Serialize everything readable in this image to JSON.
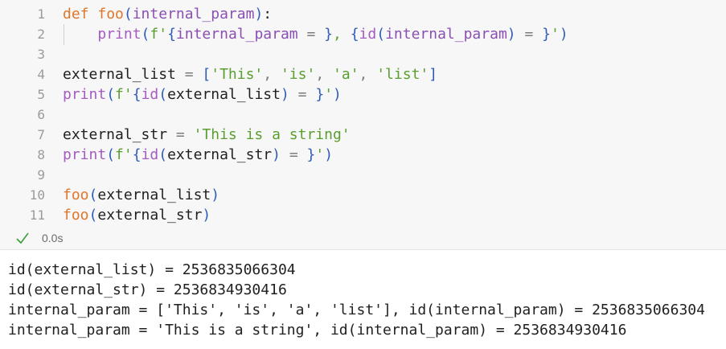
{
  "code": {
    "lines": [
      {
        "num": "1",
        "tokens": [
          [
            "kw",
            "def "
          ],
          [
            "fn",
            "foo"
          ],
          [
            "br",
            "("
          ],
          [
            "var",
            "internal_param"
          ],
          [
            "br",
            ")"
          ],
          [
            "txt",
            ":"
          ]
        ]
      },
      {
        "num": "2",
        "tokens": [
          [
            "txt",
            "    "
          ],
          [
            "bi",
            "print"
          ],
          [
            "br",
            "("
          ],
          [
            "str",
            "f'"
          ],
          [
            "br",
            "{"
          ],
          [
            "var",
            "internal_param"
          ],
          [
            "op",
            " = "
          ],
          [
            "br",
            "}"
          ],
          [
            "str",
            ", "
          ],
          [
            "br",
            "{"
          ],
          [
            "bi",
            "id"
          ],
          [
            "br",
            "("
          ],
          [
            "var",
            "internal_param"
          ],
          [
            "br",
            ")"
          ],
          [
            "op",
            " = "
          ],
          [
            "br",
            "}"
          ],
          [
            "str",
            "'"
          ],
          [
            "br",
            ")"
          ]
        ]
      },
      {
        "num": "3",
        "tokens": []
      },
      {
        "num": "4",
        "tokens": [
          [
            "txt",
            "external_list "
          ],
          [
            "op",
            "="
          ],
          [
            "txt",
            " "
          ],
          [
            "br",
            "["
          ],
          [
            "str",
            "'This'"
          ],
          [
            "op",
            ", "
          ],
          [
            "str",
            "'is'"
          ],
          [
            "op",
            ", "
          ],
          [
            "str",
            "'a'"
          ],
          [
            "op",
            ", "
          ],
          [
            "str",
            "'list'"
          ],
          [
            "br",
            "]"
          ]
        ]
      },
      {
        "num": "5",
        "tokens": [
          [
            "bi",
            "print"
          ],
          [
            "br",
            "("
          ],
          [
            "str",
            "f'"
          ],
          [
            "br",
            "{"
          ],
          [
            "bi",
            "id"
          ],
          [
            "br",
            "("
          ],
          [
            "txt",
            "external_list"
          ],
          [
            "br",
            ")"
          ],
          [
            "op",
            " = "
          ],
          [
            "br",
            "}"
          ],
          [
            "str",
            "'"
          ],
          [
            "br",
            ")"
          ]
        ]
      },
      {
        "num": "6",
        "tokens": []
      },
      {
        "num": "7",
        "tokens": [
          [
            "txt",
            "external_str "
          ],
          [
            "op",
            "="
          ],
          [
            "txt",
            " "
          ],
          [
            "str",
            "'This is a string'"
          ]
        ]
      },
      {
        "num": "8",
        "tokens": [
          [
            "bi",
            "print"
          ],
          [
            "br",
            "("
          ],
          [
            "str",
            "f'"
          ],
          [
            "br",
            "{"
          ],
          [
            "bi",
            "id"
          ],
          [
            "br",
            "("
          ],
          [
            "txt",
            "external_str"
          ],
          [
            "br",
            ")"
          ],
          [
            "op",
            " = "
          ],
          [
            "br",
            "}"
          ],
          [
            "str",
            "'"
          ],
          [
            "br",
            ")"
          ]
        ]
      },
      {
        "num": "9",
        "tokens": []
      },
      {
        "num": "10",
        "tokens": [
          [
            "fn",
            "foo"
          ],
          [
            "br",
            "("
          ],
          [
            "txt",
            "external_list"
          ],
          [
            "br",
            ")"
          ]
        ]
      },
      {
        "num": "11",
        "tokens": [
          [
            "fn",
            "foo"
          ],
          [
            "br",
            "("
          ],
          [
            "txt",
            "external_str"
          ],
          [
            "br",
            ")"
          ]
        ]
      }
    ]
  },
  "status": {
    "icon": "check-icon",
    "time": "0.0s",
    "check_color": "#3a9d3a"
  },
  "output": {
    "lines": [
      "id(external_list) = 2536835066304",
      "id(external_str) = 2536834930416",
      "internal_param = ['This', 'is', 'a', 'list'], id(internal_param) = 2536835066304",
      "internal_param = 'This is a string', id(internal_param) = 2536834930416"
    ]
  }
}
